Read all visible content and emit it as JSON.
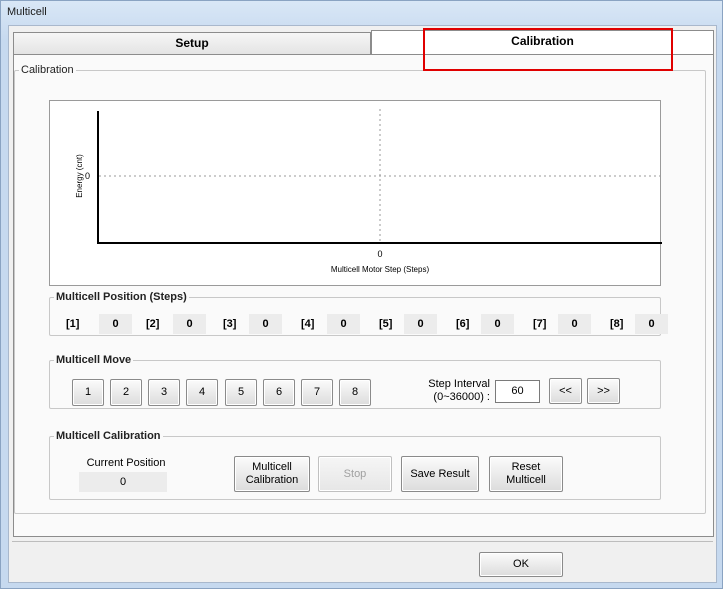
{
  "window": {
    "title": "Multicell"
  },
  "tabs": [
    {
      "label": "Setup"
    },
    {
      "label": "Calibration"
    }
  ],
  "calibration_group": {
    "label": "Calibration"
  },
  "chart": {
    "ylabel": "Energy (cnt)",
    "xlabel": "Multicell Motor Step (Steps)",
    "x_tick": "0",
    "y_tick": "0"
  },
  "chart_data": {
    "type": "line",
    "title": "",
    "xlabel": "Multicell Motor Step (Steps)",
    "ylabel": "Energy (cnt)",
    "x_ticks": [
      "0"
    ],
    "y_ticks": [
      "0"
    ],
    "series": [],
    "grid": true
  },
  "position": {
    "label": "Multicell Position (Steps)",
    "items": [
      {
        "label": "[1]",
        "value": "0"
      },
      {
        "label": "[2]",
        "value": "0"
      },
      {
        "label": "[3]",
        "value": "0"
      },
      {
        "label": "[4]",
        "value": "0"
      },
      {
        "label": "[5]",
        "value": "0"
      },
      {
        "label": "[6]",
        "value": "0"
      },
      {
        "label": "[7]",
        "value": "0"
      },
      {
        "label": "[8]",
        "value": "0"
      }
    ]
  },
  "move": {
    "label": "Multicell Move",
    "buttons": [
      "1",
      "2",
      "3",
      "4",
      "5",
      "6",
      "7",
      "8"
    ],
    "step_interval_label_1": "Step Interval",
    "step_interval_label_2": "(0~36000) :",
    "step_interval_value": "60",
    "prev_label": "<<",
    "next_label": ">>"
  },
  "calibration": {
    "label": "Multicell Calibration",
    "current_position_label": "Current Position",
    "current_position_value": "0",
    "multicell_calibration_1": "Multicell",
    "multicell_calibration_2": "Calibration",
    "stop_label": "Stop",
    "save_result_label": "Save Result",
    "reset_1": "Reset",
    "reset_2": "Multicell"
  },
  "footer": {
    "ok_label": "OK"
  },
  "colors": {
    "highlight": "#e00000"
  }
}
